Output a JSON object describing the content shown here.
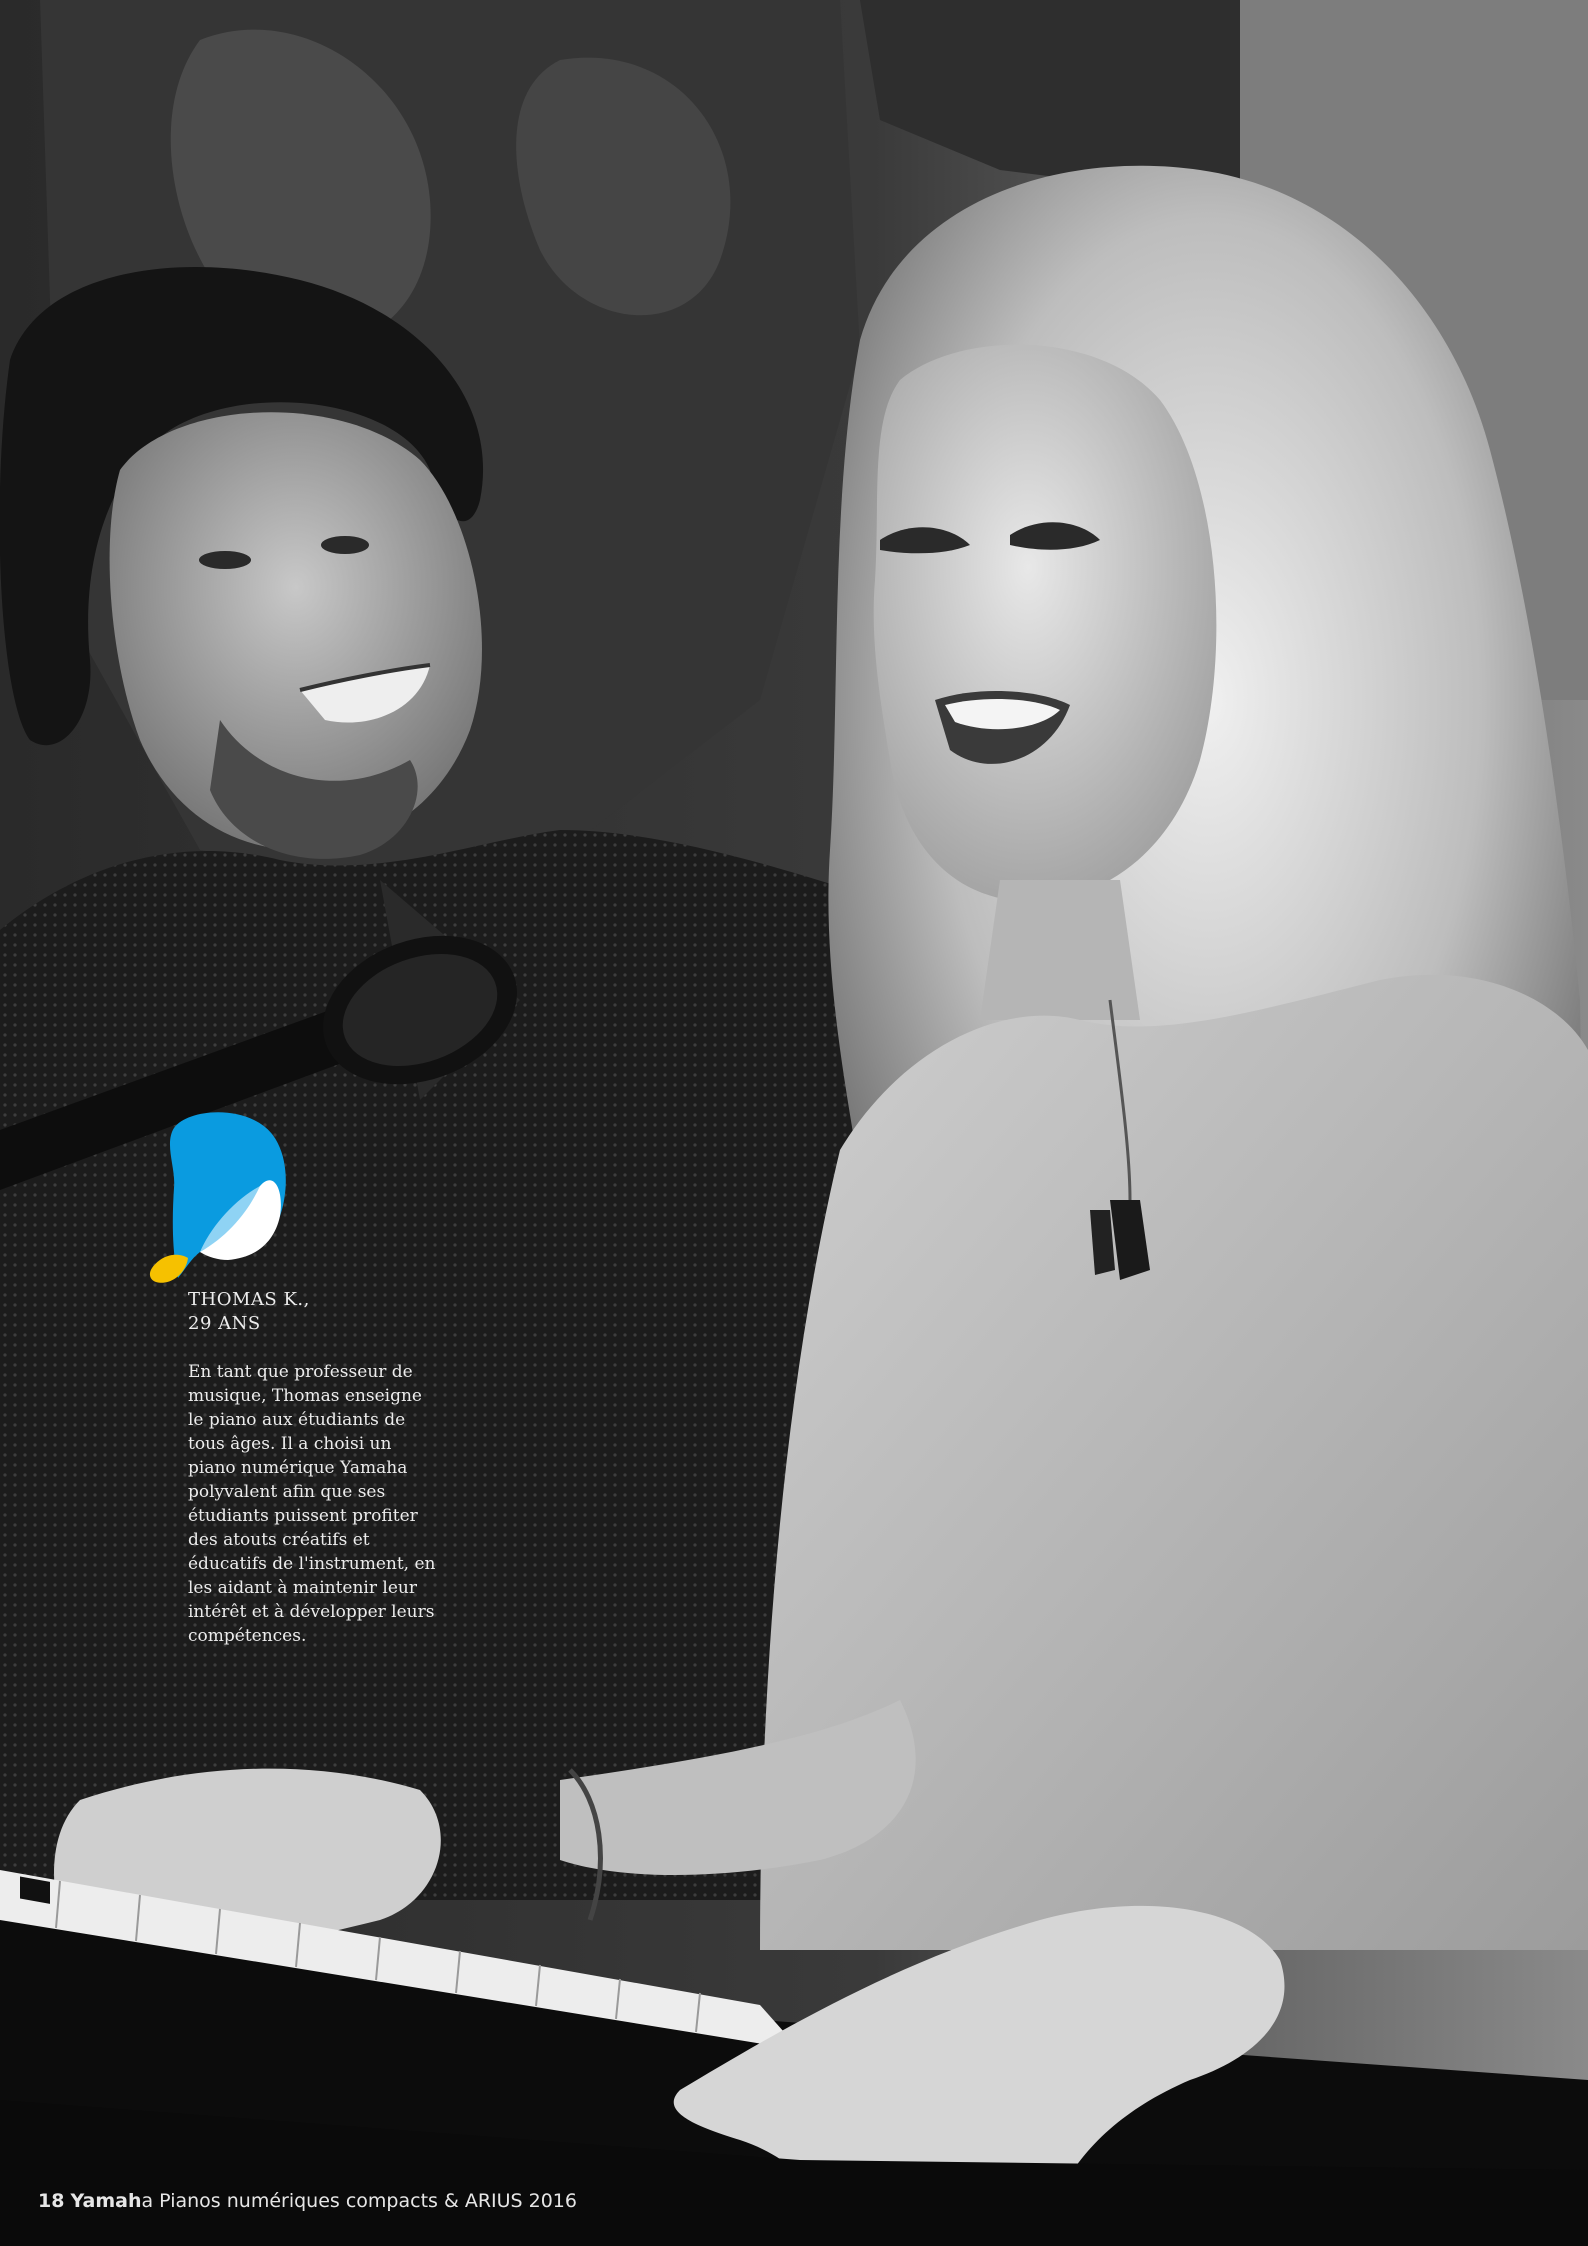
{
  "profile": {
    "name_line1": "THOMAS K.,",
    "name_line2": "29 ANS",
    "bio": "En tant que professeur de musique, Thomas enseigne le piano aux étudiants de tous âges. Il a choisi un piano numérique Yamaha polyvalent afin que ses étudiants puissent profiter des atouts créatifs et éducatifs de l'instrument, en les aidant à maintenir leur intérêt et à développer leurs compétences."
  },
  "footer": {
    "page_number": "18",
    "brand": "Yamah",
    "brand_tail": "a",
    "title": " Pianos numériques compacts & ARIUS 2016"
  },
  "logo": {
    "icon": "yamaha-music-drop-icon",
    "colors": {
      "blue": "#0a9be0",
      "light_blue": "#8fd3f4",
      "white": "#ffffff",
      "yellow": "#f6c100"
    }
  }
}
